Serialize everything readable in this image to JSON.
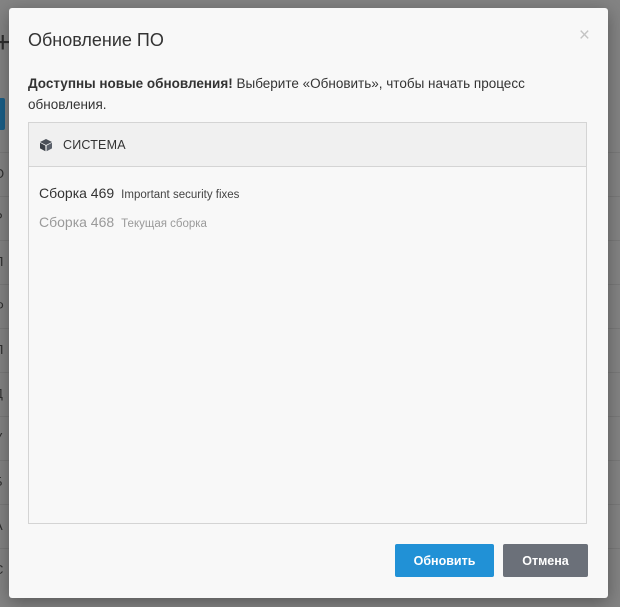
{
  "dialog": {
    "title": "Обновление ПО",
    "close_glyph": "×",
    "message_bold": "Доступны новые обновления!",
    "message_rest": " Выберите «Обновить», чтобы начать процесс обновления."
  },
  "panel": {
    "icon": "cube-icon",
    "title": "СИСТЕМА"
  },
  "builds": [
    {
      "name": "Сборка 469",
      "description": "Important security fixes",
      "current": false
    },
    {
      "name": "Сборка 468",
      "description": "Текущая сборка",
      "current": true
    }
  ],
  "buttons": {
    "update": "Обновить",
    "cancel": "Отмена"
  },
  "colors": {
    "primary": "#2191d6",
    "secondary": "#6b7079"
  },
  "background": {
    "plus_glyph": "+",
    "row_letters": [
      "О",
      "Р",
      "П",
      "Ф",
      "П",
      "Д",
      "У",
      "Б",
      "А",
      "С"
    ]
  }
}
